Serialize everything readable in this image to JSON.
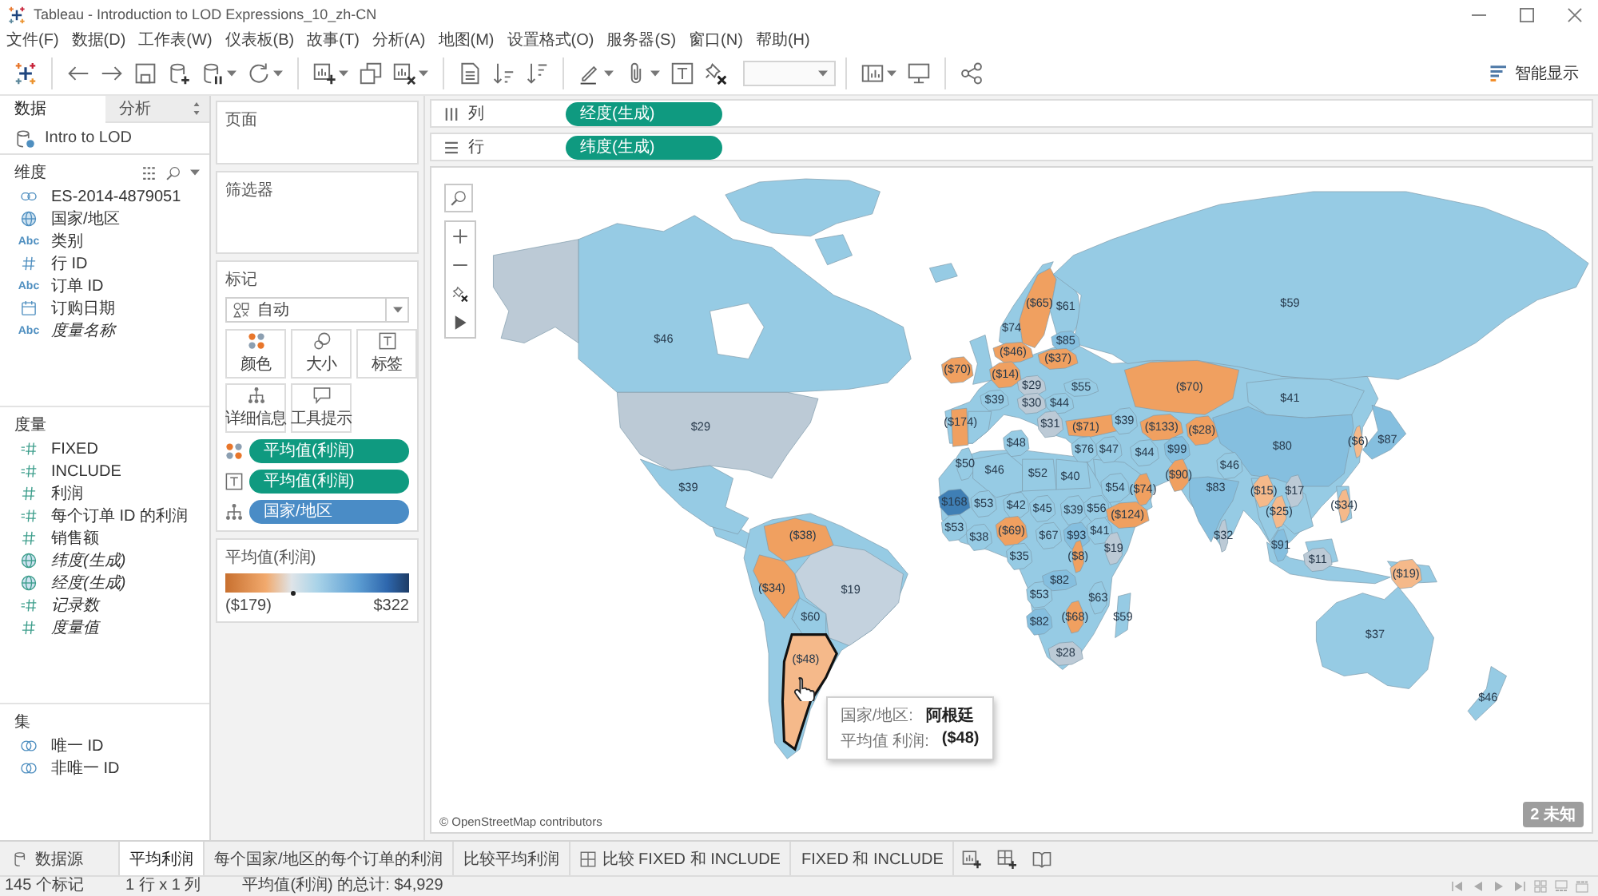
{
  "window": {
    "title": "Tableau - Introduction to LOD Expressions_10_zh-CN"
  },
  "menu": [
    "文件(F)",
    "数据(D)",
    "工作表(W)",
    "仪表板(B)",
    "故事(T)",
    "分析(A)",
    "地图(M)",
    "设置格式(O)",
    "服务器(S)",
    "窗口(N)",
    "帮助(H)"
  ],
  "toolbar": {
    "groups": [
      [
        {
          "kind": "logo",
          "dropdown": false
        }
      ],
      [
        {
          "kind": "back",
          "dropdown": false
        },
        {
          "kind": "forward",
          "dropdown": false
        },
        {
          "kind": "save",
          "dropdown": false
        },
        {
          "kind": "new_source",
          "dropdown": false
        },
        {
          "kind": "pause",
          "dropdown": true
        },
        {
          "kind": "refresh",
          "dropdown": true
        }
      ],
      [
        {
          "kind": "new_sheet",
          "dropdown": true
        },
        {
          "kind": "duplicate",
          "dropdown": false
        },
        {
          "kind": "clear",
          "dropdown": true
        }
      ],
      [
        {
          "kind": "swap",
          "dropdown": false
        },
        {
          "kind": "sort_asc",
          "dropdown": false
        },
        {
          "kind": "sort_desc",
          "dropdown": false
        }
      ],
      [
        {
          "kind": "highlight",
          "dropdown": true
        },
        {
          "kind": "group",
          "dropdown": true
        },
        {
          "kind": "labels",
          "dropdown": false
        },
        {
          "kind": "fix_axes",
          "dropdown": false
        },
        {
          "kind": "fit",
          "dropdown": true
        }
      ],
      [
        {
          "kind": "cards",
          "dropdown": true
        },
        {
          "kind": "present",
          "dropdown": false
        }
      ],
      [
        {
          "kind": "share",
          "dropdown": false
        }
      ]
    ],
    "show_me": "智能显示"
  },
  "data_pane": {
    "tabs": [
      {
        "label": "数据",
        "selected": true
      },
      {
        "label": "分析",
        "selected": false
      }
    ],
    "source": "Intro to LOD",
    "sections": [
      {
        "title": "维度",
        "items": [
          {
            "label": "ES-2014-4879051",
            "kind": "group",
            "italic": false
          },
          {
            "label": "国家/地区",
            "kind": "geo",
            "italic": false
          },
          {
            "label": "类别",
            "kind": "string",
            "glyph": "Abc",
            "italic": false
          },
          {
            "label": "行 ID",
            "kind": "number",
            "italic": false
          },
          {
            "label": "订单 ID",
            "kind": "string",
            "glyph": "Abc",
            "italic": false
          },
          {
            "label": "订购日期",
            "kind": "date",
            "italic": false
          },
          {
            "label": "度量名称",
            "kind": "string",
            "glyph": "Abc",
            "italic": true
          }
        ]
      },
      {
        "title": "度量",
        "items": [
          {
            "label": "FIXED",
            "kind": "calc",
            "italic": false
          },
          {
            "label": "INCLUDE",
            "kind": "calc",
            "italic": false
          },
          {
            "label": "利润",
            "kind": "number",
            "italic": false
          },
          {
            "label": "每个订单 ID 的利润",
            "kind": "calc",
            "italic": false
          },
          {
            "label": "销售额",
            "kind": "number",
            "italic": false
          },
          {
            "label": "纬度(生成)",
            "kind": "geo",
            "italic": true
          },
          {
            "label": "经度(生成)",
            "kind": "geo",
            "italic": true
          },
          {
            "label": "记录数",
            "kind": "calc",
            "italic": true
          },
          {
            "label": "度量值",
            "kind": "number",
            "italic": true
          }
        ]
      },
      {
        "title": "集",
        "items": [
          {
            "label": "唯一 ID",
            "kind": "set",
            "italic": false
          },
          {
            "label": "非唯一 ID",
            "kind": "set",
            "italic": false
          }
        ]
      }
    ]
  },
  "cards": {
    "pages": {
      "title": "页面"
    },
    "filters": {
      "title": "筛选器"
    },
    "marks": {
      "title": "标记",
      "mark_type": "自动",
      "buttons": [
        {
          "label": "颜色",
          "kind": "color"
        },
        {
          "label": "大小",
          "kind": "size"
        },
        {
          "label": "标签",
          "kind": "label"
        },
        {
          "label": "详细信息",
          "kind": "detail"
        },
        {
          "label": "工具提示",
          "kind": "tooltip"
        }
      ],
      "pills": [
        {
          "kind": "color",
          "label": "平均值(利润)",
          "color": "#0f9a80"
        },
        {
          "kind": "label",
          "label": "平均值(利润)",
          "color": "#0f9a80"
        },
        {
          "kind": "detail",
          "label": "国家/地区",
          "color": "#4a8cc6"
        }
      ]
    },
    "legend": {
      "title": "平均值(利润)",
      "min": "($179)",
      "max": "$322"
    }
  },
  "columns": {
    "label": "列",
    "pills": [
      {
        "label": "经度(生成)",
        "color": "#0f9a80"
      }
    ]
  },
  "rows": {
    "label": "行",
    "pills": [
      {
        "label": "纬度(生成)",
        "color": "#0f9a80"
      }
    ]
  },
  "map": {
    "regions": [
      {
        "label": "($65)",
        "color": "#f0a060",
        "hovered": false
      },
      {
        "label": "$61",
        "color": "#96cbe4",
        "hovered": false
      },
      {
        "label": "$59",
        "color": "#96cbe4",
        "hovered": false
      },
      {
        "label": "$74",
        "color": "#96cbe4",
        "hovered": false
      },
      {
        "label": "$46",
        "color": "#96cbe4",
        "hovered": false
      },
      {
        "label": "$85",
        "color": "#85bfdf",
        "hovered": false
      },
      {
        "label": "($46)",
        "color": "#f0a060",
        "hovered": false
      },
      {
        "label": "($37)",
        "color": "#f0a060",
        "hovered": false
      },
      {
        "label": "($70)",
        "color": "#f0a060",
        "hovered": false
      },
      {
        "color": "#96cbe4",
        "hovered": false
      },
      {
        "label": "($14)",
        "color": "#f0a060",
        "hovered": false
      },
      {
        "label": "$29",
        "color": "#bccad6",
        "hovered": false
      },
      {
        "label": "$55",
        "color": "#96cbe4",
        "hovered": false
      },
      {
        "label": "($70)",
        "color": "#f0a060",
        "hovered": false
      },
      {
        "label": "$39",
        "color": "#96cbe4",
        "hovered": false
      },
      {
        "label": "$30",
        "color": "#bccad6",
        "hovered": false
      },
      {
        "label": "$44",
        "color": "#96cbe4",
        "hovered": false
      },
      {
        "label": "$41",
        "color": "#96cbe4",
        "hovered": false
      },
      {
        "label": "$29",
        "color": "#bccad6",
        "hovered": false
      },
      {
        "color": "#96cbe4",
        "hovered": false
      },
      {
        "label": "($174)",
        "color": "#f0a060",
        "hovered": false
      },
      {
        "label": "$31",
        "color": "#bccad6",
        "hovered": false
      },
      {
        "label": "($71)",
        "color": "#f0a060",
        "hovered": false
      },
      {
        "label": "$39",
        "color": "#96cbe4",
        "hovered": false
      },
      {
        "label": "($133)",
        "color": "#f0a060",
        "hovered": false
      },
      {
        "label": "($28)",
        "color": "#f0a060",
        "hovered": false
      },
      {
        "label": "$48",
        "color": "#96cbe4",
        "hovered": false
      },
      {
        "label": "$76",
        "color": "#96cbe4",
        "hovered": false
      },
      {
        "label": "$47",
        "color": "#96cbe4",
        "hovered": false
      },
      {
        "label": "$44",
        "color": "#96cbe4",
        "hovered": false
      },
      {
        "label": "$99",
        "color": "#85bfdf",
        "hovered": false
      },
      {
        "label": "$80",
        "color": "#85bfdf",
        "hovered": false
      },
      {
        "label": "($6)",
        "color": "#f5b98a",
        "hovered": false
      },
      {
        "label": "$87",
        "color": "#85bfdf",
        "hovered": false
      },
      {
        "label": "$50",
        "color": "#96cbe4",
        "hovered": false
      },
      {
        "label": "$46",
        "color": "#96cbe4",
        "hovered": false
      },
      {
        "label": "$52",
        "color": "#96cbe4",
        "hovered": false
      },
      {
        "label": "$40",
        "color": "#96cbe4",
        "hovered": false
      },
      {
        "label": "($90)",
        "color": "#f0a060",
        "hovered": false
      },
      {
        "label": "$46",
        "color": "#96cbe4",
        "hovered": false
      },
      {
        "label": "$39",
        "color": "#96cbe4",
        "hovered": false
      },
      {
        "label": "$54",
        "color": "#96cbe4",
        "hovered": false
      },
      {
        "label": "($74)",
        "color": "#f0a060",
        "hovered": false
      },
      {
        "label": "$83",
        "color": "#85bfdf",
        "hovered": false
      },
      {
        "label": "($15)",
        "color": "#f5b98a",
        "hovered": false
      },
      {
        "label": "$17",
        "color": "#bccad6",
        "hovered": false
      },
      {
        "label": "$168",
        "color": "#3f7fb5",
        "hovered": false
      },
      {
        "label": "$53",
        "color": "#96cbe4",
        "hovered": false
      },
      {
        "label": "$42",
        "color": "#96cbe4",
        "hovered": false
      },
      {
        "label": "$45",
        "color": "#96cbe4",
        "hovered": false
      },
      {
        "label": "$39",
        "color": "#96cbe4",
        "hovered": false
      },
      {
        "label": "$56",
        "color": "#96cbe4",
        "hovered": false
      },
      {
        "label": "($124)",
        "color": "#f0a060",
        "hovered": false
      },
      {
        "label": "($25)",
        "color": "#f5b98a",
        "hovered": false
      },
      {
        "label": "($34)",
        "color": "#f5b98a",
        "hovered": false
      },
      {
        "label": "($38)",
        "color": "#f0a060",
        "hovered": false
      },
      {
        "label": "$53",
        "color": "#96cbe4",
        "hovered": false
      },
      {
        "label": "$38",
        "color": "#96cbe4",
        "hovered": false
      },
      {
        "label": "($69)",
        "color": "#f0a060",
        "hovered": false
      },
      {
        "label": "$67",
        "color": "#96cbe4",
        "hovered": false
      },
      {
        "label": "$93",
        "color": "#85bfdf",
        "hovered": false
      },
      {
        "label": "$41",
        "color": "#96cbe4",
        "hovered": false
      },
      {
        "label": "$32",
        "color": "#bccad6",
        "hovered": false
      },
      {
        "label": "$35",
        "color": "#96cbe4",
        "hovered": false
      },
      {
        "label": "($8)",
        "color": "#f0a060",
        "hovered": false
      },
      {
        "label": "$19",
        "color": "#bccad6",
        "hovered": false
      },
      {
        "label": "$91",
        "color": "#85bfdf",
        "hovered": false
      },
      {
        "label": "$11",
        "color": "#bccad6",
        "hovered": false
      },
      {
        "label": "($34)",
        "color": "#f0a060",
        "hovered": false
      },
      {
        "label": "$19",
        "color": "#c4d2de",
        "hovered": false
      },
      {
        "label": "$53",
        "color": "#96cbe4",
        "hovered": false
      },
      {
        "label": "$82",
        "color": "#85bfdf",
        "hovered": false
      },
      {
        "label": "$63",
        "color": "#96cbe4",
        "hovered": false
      },
      {
        "label": "($19)",
        "color": "#f5b98a",
        "hovered": false
      },
      {
        "label": "$60",
        "color": "#96cbe4",
        "hovered": false
      },
      {
        "label": "$82",
        "color": "#85bfdf",
        "hovered": false
      },
      {
        "label": "($68)",
        "color": "#f0a060",
        "hovered": false
      },
      {
        "label": "$59",
        "color": "#96cbe4",
        "hovered": false
      },
      {
        "label": "$37",
        "color": "#96cbe4",
        "hovered": false
      },
      {
        "label": "($48)",
        "color": "#f5b98a",
        "hovered": true
      },
      {
        "label": "$28",
        "color": "#bccad6",
        "hovered": false
      },
      {
        "label": "$46",
        "color": "#96cbe4",
        "hovered": false
      }
    ],
    "tooltip": {
      "rows": [
        {
          "name": "国家/地区:",
          "value": "阿根廷"
        },
        {
          "name": "平均值 利润:",
          "value": "($48)"
        }
      ]
    },
    "attribution": "© OpenStreetMap contributors",
    "unknown": "2 未知"
  },
  "sheet_tabs": [
    {
      "label": "数据源",
      "kind": "datasource",
      "selected": false
    },
    {
      "label": "平均利润",
      "kind": "sheet",
      "selected": true
    },
    {
      "label": "每个国家/地区的每个订单的利润",
      "kind": "sheet",
      "selected": false
    },
    {
      "label": "比较平均利润",
      "kind": "sheet",
      "selected": false
    },
    {
      "label": "比较 FIXED 和 INCLUDE",
      "kind": "dashboard",
      "selected": false
    },
    {
      "label": "FIXED 和 INCLUDE",
      "kind": "sheet",
      "selected": false
    }
  ],
  "status_bar": {
    "marks": "145 个标记",
    "grid": "1 行 x 1 列",
    "total": "平均值(利润) 的总计: $4,929"
  }
}
